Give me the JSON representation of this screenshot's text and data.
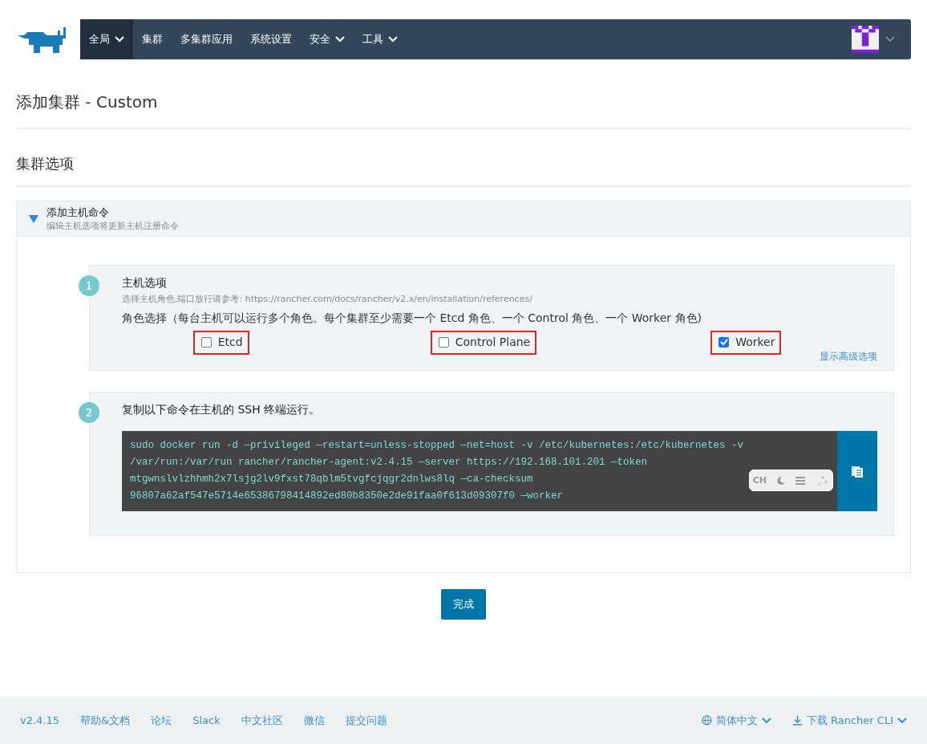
{
  "nav": {
    "items": [
      {
        "label": "全局",
        "dropdown": true,
        "selected": true
      },
      {
        "label": "集群",
        "dropdown": false,
        "selected": false
      },
      {
        "label": "多集群应用",
        "dropdown": false,
        "selected": false
      },
      {
        "label": "系统设置",
        "dropdown": false,
        "selected": false
      },
      {
        "label": "安全",
        "dropdown": true,
        "selected": false
      },
      {
        "label": "工具",
        "dropdown": true,
        "selected": false
      }
    ]
  },
  "page_title": "添加集群 - Custom",
  "section_title": "集群选项",
  "accordion": {
    "title": "添加主机命令",
    "subtitle": "编辑主机选项将更新主机注册命令",
    "expanded": true,
    "step1": {
      "number": "1",
      "title": "主机选项",
      "hint": "选择主机角色,端口放行请参考: https://rancher.com/docs/rancher/v2.x/en/installation/references/",
      "roles_label": "角色选择（每台主机可以运行多个角色。每个集群至少需要一个 Etcd 角色、一个 Control 角色、一个 Worker 角色)",
      "roles": [
        {
          "label": "Etcd",
          "checked": false,
          "highlighted": true
        },
        {
          "label": "Control Plane",
          "checked": false,
          "highlighted": true
        },
        {
          "label": "Worker",
          "checked": true,
          "highlighted": true
        }
      ],
      "advanced_link": "显示高级选项"
    },
    "step2": {
      "number": "2",
      "title": "复制以下命令在主机的 SSH 终端运行。",
      "command_lines": [
        "sudo docker run -d —privileged —restart=unless-stopped —net=host -v /etc/kubernetes:/etc/kubernetes -v",
        "/var/run:/var/run rancher/rancher-agent:v2.4.15 —server https://192.168.101.201 —token",
        "mtgwnslvlzhhmh2x7lsjg2lv9fxst78qblm5tvgfcjqgr2dnlws8lq —ca-checksum",
        "96807a62af547e5714e65386798414892ed80b8350e2de91faa0f613d09307f0 —worker"
      ],
      "overlay_widget": {
        "label": "CH"
      }
    }
  },
  "done_button": "完成",
  "footer": {
    "links": [
      "v2.4.15",
      "帮助&文档",
      "论坛",
      "Slack",
      "中文社区",
      "微信",
      "提交问题"
    ],
    "language": "简体中文",
    "download": "下载 Rancher CLI"
  }
}
